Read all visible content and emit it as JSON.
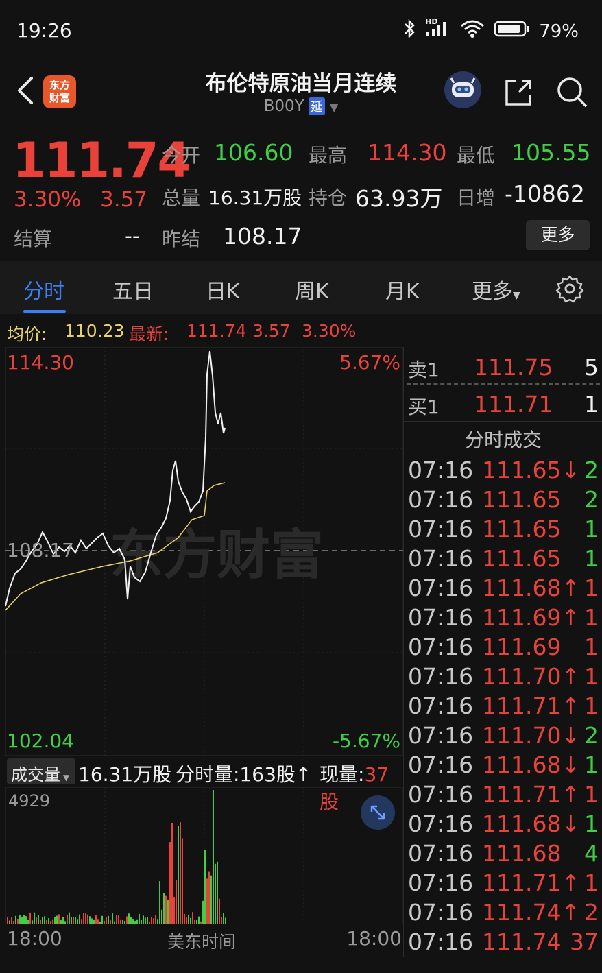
{
  "status": {
    "time": "19:26",
    "battery": "79%",
    "hd": "HD"
  },
  "header": {
    "title": "布伦特原油当月连续",
    "code": "B00Y",
    "delay_badge": "延",
    "logo_line1": "东方",
    "logo_line2": "财富"
  },
  "quote": {
    "price": "111.74",
    "change_pct": "3.30%",
    "change_val": "3.57",
    "open_label": "今开",
    "open": "106.60",
    "high_label": "最高",
    "high": "114.30",
    "low_label": "最低",
    "low": "105.55",
    "volume_label": "总量",
    "volume": "16.31万股",
    "oi_label": "持仓",
    "oi": "63.93万",
    "daily_inc_label": "日增",
    "daily_inc": "-10862",
    "settle_label": "结算",
    "settle": "--",
    "prev_settle_label": "昨结",
    "prev_settle": "108.17",
    "more_label": "更多"
  },
  "tabs": [
    {
      "label": "分时",
      "active": true
    },
    {
      "label": "五日"
    },
    {
      "label": "日K"
    },
    {
      "label": "周K"
    },
    {
      "label": "月K"
    },
    {
      "label": "更多"
    }
  ],
  "avgbar": {
    "avg_label": "均价:",
    "avg": "110.23",
    "latest_label": "最新:",
    "latest": "111.74",
    "chg": "3.57",
    "pct": "3.30%"
  },
  "chart": {
    "top_price": "114.30",
    "bottom_price": "102.04",
    "mid_price": "108.17",
    "top_pct": "5.67%",
    "bottom_pct": "-5.67%",
    "watermark": "东方财富"
  },
  "volume": {
    "selector_label": "成交量",
    "total": "16.31万股",
    "tick_label": "分时量:163股↑",
    "current_label": "现量:",
    "current": "37股",
    "max": "4929",
    "axis_left": "18:00",
    "axis_mid": "美东时间",
    "axis_right": "18:00"
  },
  "book": {
    "ask_label": "卖1",
    "ask_price": "111.75",
    "ask_qty": "5",
    "bid_label": "买1",
    "bid_price": "111.71",
    "bid_qty": "1",
    "ticks_title": "分时成交",
    "ticks": [
      {
        "time": "07:16",
        "price": "111.65↓",
        "qty": "2",
        "qc": "green"
      },
      {
        "time": "07:16",
        "price": "111.65",
        "qty": "2",
        "qc": "green"
      },
      {
        "time": "07:16",
        "price": "111.65",
        "qty": "1",
        "qc": "green"
      },
      {
        "time": "07:16",
        "price": "111.65",
        "qty": "1",
        "qc": "green"
      },
      {
        "time": "07:16",
        "price": "111.68↑",
        "qty": "1",
        "qc": "red"
      },
      {
        "time": "07:16",
        "price": "111.69↑",
        "qty": "1",
        "qc": "red"
      },
      {
        "time": "07:16",
        "price": "111.69",
        "qty": "1",
        "qc": "red"
      },
      {
        "time": "07:16",
        "price": "111.70↑",
        "qty": "1",
        "qc": "red"
      },
      {
        "time": "07:16",
        "price": "111.71↑",
        "qty": "1",
        "qc": "red"
      },
      {
        "time": "07:16",
        "price": "111.70↓",
        "qty": "2",
        "qc": "green"
      },
      {
        "time": "07:16",
        "price": "111.68↓",
        "qty": "1",
        "qc": "green"
      },
      {
        "time": "07:16",
        "price": "111.71↑",
        "qty": "1",
        "qc": "red"
      },
      {
        "time": "07:16",
        "price": "111.68↓",
        "qty": "1",
        "qc": "green"
      },
      {
        "time": "07:16",
        "price": "111.68",
        "qty": "4",
        "qc": "green"
      },
      {
        "time": "07:16",
        "price": "111.71↑",
        "qty": "1",
        "qc": "red"
      },
      {
        "time": "07:16",
        "price": "111.74↑",
        "qty": "2",
        "qc": "red"
      },
      {
        "time": "07:16",
        "price": "111.74",
        "qty": "37",
        "qc": "red"
      }
    ]
  },
  "colors": {
    "up": "#e8423b",
    "down": "#3fcf45",
    "accent": "#3b7ff0",
    "avg_line": "#e8d36a"
  }
}
